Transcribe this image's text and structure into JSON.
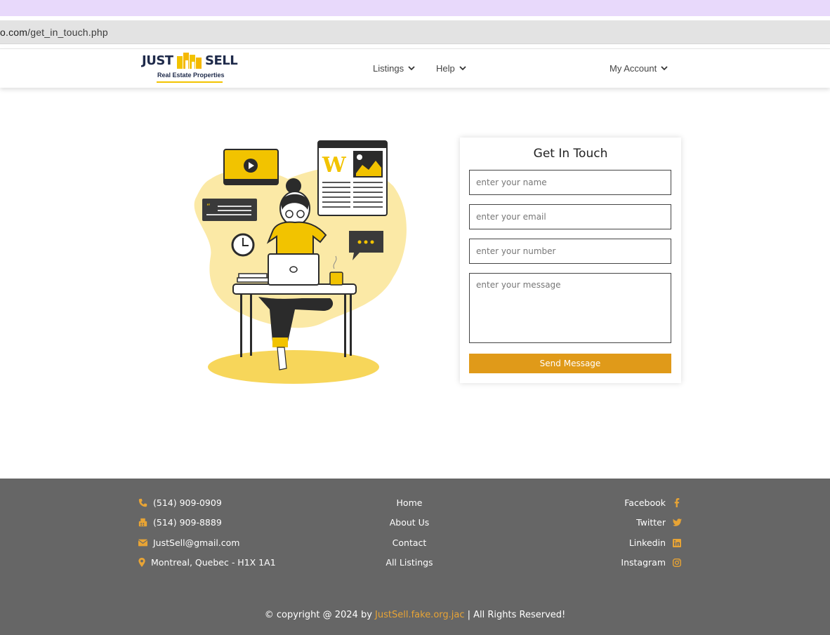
{
  "browser": {
    "url_host": "o.com",
    "url_path": "/get_in_touch.php"
  },
  "logo": {
    "word_left": "JUST",
    "word_right": "SELL",
    "tagline": "Real Estate Properties"
  },
  "nav": {
    "listings": "Listings",
    "help": "Help",
    "account": "My Account"
  },
  "contact_form": {
    "title": "Get In Touch",
    "name_placeholder": "enter your name",
    "email_placeholder": "enter your email",
    "number_placeholder": "enter your number",
    "message_placeholder": "enter your message",
    "submit_label": "Send Message"
  },
  "footer": {
    "contact": [
      {
        "icon": "phone-icon",
        "text": "(514) 909-0909"
      },
      {
        "icon": "fax-icon",
        "text": "(514) 909-8889"
      },
      {
        "icon": "envelope-icon",
        "text": "JustSell@gmail.com"
      },
      {
        "icon": "map-marker-icon",
        "text": "Montreal, Quebec - H1X 1A1"
      }
    ],
    "links": [
      "Home",
      "About Us",
      "Contact",
      "All Listings"
    ],
    "social": [
      {
        "icon": "facebook-icon",
        "text": "Facebook"
      },
      {
        "icon": "twitter-icon",
        "text": "Twitter"
      },
      {
        "icon": "linkedin-icon",
        "text": "Linkedin"
      },
      {
        "icon": "instagram-icon",
        "text": "Instagram"
      }
    ],
    "copyright_prefix": "© copyright @ 2024 by ",
    "copyright_brand": "JustSell.fake.org.jac",
    "copyright_suffix": " | All Rights Reserved!"
  },
  "colors": {
    "accent": "#e09a19",
    "footer_bg": "#666666",
    "brand_navy": "#1e2a4a",
    "brand_yellow": "#f2c300",
    "tab_strip": "#e8d9fb"
  }
}
